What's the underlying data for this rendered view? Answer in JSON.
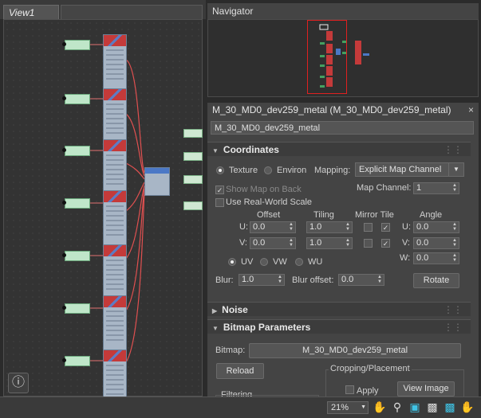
{
  "view": {
    "tab_label": "View1",
    "help_icon": "help-icon"
  },
  "navigator": {
    "title": "Navigator"
  },
  "material": {
    "title": "M_30_MD0_dev259_metal  (M_30_MD0_dev259_metal)",
    "close": "×",
    "name_value": "M_30_MD0_dev259_metal"
  },
  "coordinates": {
    "header": "Coordinates",
    "texture_label": "Texture",
    "environ_label": "Environ",
    "mapping_label": "Mapping:",
    "mapping_value": "Explicit Map Channel",
    "show_map_on_back": "Show Map on Back",
    "map_channel_label": "Map Channel:",
    "map_channel_value": "1",
    "use_real_world": "Use Real-World Scale",
    "col_offset": "Offset",
    "col_tiling": "Tiling",
    "col_mirror_tile": "Mirror Tile",
    "col_angle": "Angle",
    "u_label": "U:",
    "v_label": "V:",
    "w_label": "W:",
    "offset_u": "0.0",
    "offset_v": "0.0",
    "tiling_u": "1.0",
    "tiling_v": "1.0",
    "angle_u": "0.0",
    "angle_v": "0.0",
    "angle_w": "0.0",
    "uv": "UV",
    "vw": "VW",
    "wu": "WU",
    "blur_label": "Blur:",
    "blur_value": "1.0",
    "blur_offset_label": "Blur offset:",
    "blur_offset_value": "0.0",
    "rotate_button": "Rotate"
  },
  "noise": {
    "header": "Noise"
  },
  "bitmap_params": {
    "header": "Bitmap Parameters",
    "bitmap_label": "Bitmap:",
    "bitmap_value": "M_30_MD0_dev259_metal",
    "reload_button": "Reload",
    "cropping_label": "Cropping/Placement",
    "apply_label": "Apply",
    "view_image_button": "View Image",
    "filtering_label": "Filtering"
  },
  "statusbar": {
    "zoom_value": "21%",
    "icons": [
      "pan-icon",
      "zoom-icon",
      "zoom-region-icon",
      "zoom-extents-icon",
      "zoom-extents-selected-icon",
      "hand-highlight-icon"
    ]
  },
  "colors": {
    "accent": "#e02020",
    "node_red": "#c43a3a",
    "node_blue": "#4b78c6",
    "wire": "#e05050",
    "highlight": "#3fc4e6"
  }
}
